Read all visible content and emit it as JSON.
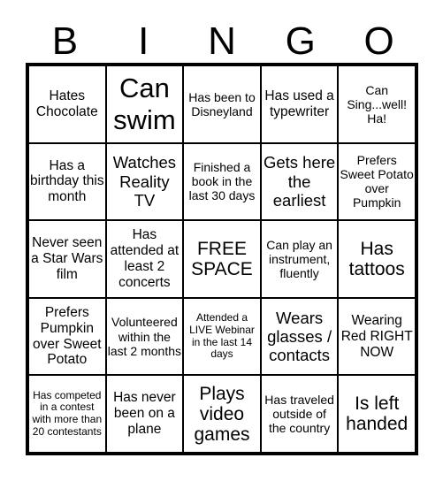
{
  "header": {
    "letters": [
      "B",
      "I",
      "N",
      "G",
      "O"
    ]
  },
  "rows": [
    [
      "Hates Chocolate",
      "Can swim",
      "Has been to Disneyland",
      "Has used a typewriter",
      "Can Sing...well! Ha!"
    ],
    [
      "Has a birthday this month",
      "Watches Reality TV",
      "Finished a book in the last 30 days",
      "Gets here the earliest",
      "Prefers Sweet Potato over Pumpkin"
    ],
    [
      "Never seen a Star Wars film",
      "Has attended at least 2 concerts",
      "FREE SPACE",
      "Can play an instrument, fluently",
      "Has tattoos"
    ],
    [
      "Prefers Pumpkin over Sweet Potato",
      "Volunteered within the last 2 months",
      "Attended a LIVE Webinar in the last 14 days",
      "Wears glasses / contacts",
      "Wearing Red RIGHT NOW"
    ],
    [
      "Has competed in a contest with more than 20 contestants",
      "Has never been on a plane",
      "Plays video games",
      "Has traveled outside of the country",
      "Is left handed"
    ]
  ]
}
